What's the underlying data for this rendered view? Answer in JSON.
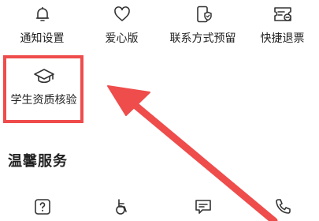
{
  "top_row": [
    {
      "label": "通知设置",
      "icon": "bell-icon"
    },
    {
      "label": "爱心版",
      "icon": "heart-icon"
    },
    {
      "label": "联系方式预留",
      "icon": "phone-shield-icon"
    },
    {
      "label": "快捷退票",
      "icon": "ticket-refund-icon"
    }
  ],
  "student": {
    "label": "学生资质核验",
    "icon": "graduation-cap-icon"
  },
  "section": {
    "title": "温馨服务"
  },
  "bottom_row": [
    {
      "icon": "question-icon"
    },
    {
      "icon": "wheelchair-icon"
    },
    {
      "icon": "message-icon"
    },
    {
      "icon": "phone-icon"
    }
  ],
  "colors": {
    "highlight": "#ef4c4c",
    "text": "#222222",
    "icon": "#333333"
  }
}
